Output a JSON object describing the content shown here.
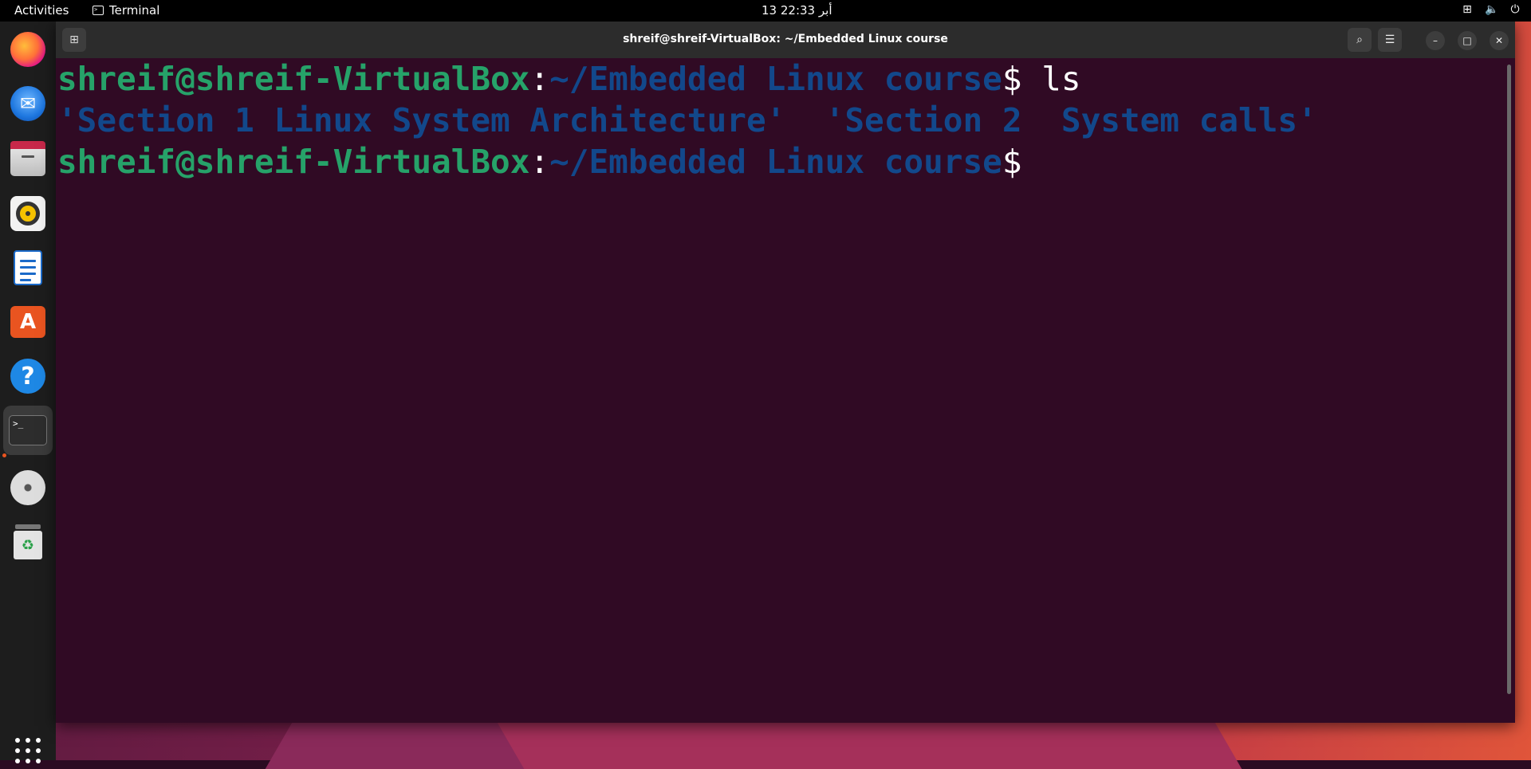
{
  "topbar": {
    "activities": "Activities",
    "app_name": "Terminal",
    "clock": "13 أبر  22:33",
    "tray_icons": [
      "network-icon",
      "volume-icon",
      "power-icon"
    ]
  },
  "dock": {
    "items": [
      {
        "name": "firefox-icon"
      },
      {
        "name": "thunderbird-icon"
      },
      {
        "name": "files-icon"
      },
      {
        "name": "rhythmbox-icon"
      },
      {
        "name": "libreoffice-writer-icon"
      },
      {
        "name": "app-center-icon",
        "glyph": "A"
      },
      {
        "name": "help-icon",
        "glyph": "?"
      },
      {
        "name": "terminal-icon",
        "glyph": ">_"
      },
      {
        "name": "disc-icon"
      },
      {
        "name": "trash-icon",
        "glyph": "♻"
      }
    ]
  },
  "window": {
    "title": "shreif@shreif-VirtualBox: ~/Embedded Linux course",
    "lines": [
      {
        "user": "shreif@shreif-VirtualBox",
        "sep": ":",
        "path": "~/Embedded Linux course",
        "dollar": "$",
        "cmd": " ls"
      },
      {
        "output": "'Section 1 Linux System Architecture'  'Section 2  System calls'"
      },
      {
        "user": "shreif@shreif-VirtualBox",
        "sep": ":",
        "path": "~/Embedded Linux course",
        "dollar": "$",
        "cmd": ""
      }
    ]
  },
  "colors": {
    "terminal_bg": "#300a24",
    "user_green": "#26a269",
    "path_blue": "#12488b",
    "accent_orange": "#e95420"
  }
}
